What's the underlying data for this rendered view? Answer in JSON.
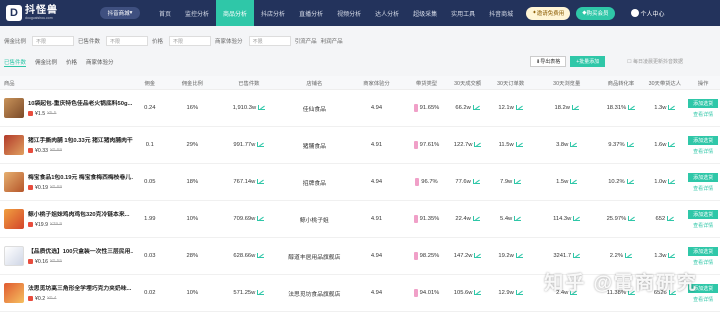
{
  "header": {
    "logo_mark": "D",
    "logo_name": "抖怪兽",
    "logo_site": "douguaishou.com",
    "platform": "抖音商城",
    "nav": [
      "首页",
      "监控分析",
      "商品分析",
      "抖店分析",
      "直播分析",
      "视频分析",
      "达人分析",
      "超级采集",
      "实用工具",
      "抖音商城"
    ],
    "active_nav": 2,
    "invite": "邀请免费用",
    "buy": "购买会员",
    "user": "个人中心"
  },
  "filters": [
    {
      "label": "佣金比例",
      "value": "不限"
    },
    {
      "label": "已售件数",
      "value": "不限"
    },
    {
      "label": "价格",
      "value": "不限"
    },
    {
      "label": "商家体验分",
      "value": "不限"
    }
  ],
  "filter_links": [
    "引流产品",
    "利润产品"
  ],
  "tabs": [
    "已售件数",
    "佣金比例",
    "价格",
    "商家体验分"
  ],
  "active_tab": 0,
  "tools": {
    "export": "导出表格",
    "add_all": "批量添加",
    "tip": "每日凌晨更新抖音数据"
  },
  "columns": [
    "商品",
    "佣金",
    "佣金比例",
    "已售件数",
    "店铺名",
    "商家体验分",
    "带货类型",
    "30天成交额",
    "30天订单数",
    "30天浏览量",
    "商品转化率",
    "30天带货达人",
    "操作"
  ],
  "rows": [
    {
      "name": "10袋起包-重庆特色佳品老火锅底料50g...",
      "price": "¥1.5",
      "old": "¥5.5",
      "comm": "0.24",
      "rate": "16%",
      "sold": "1,910.3w",
      "shop": "佳仙食品",
      "score": "4.94",
      "type": "91.65%",
      "gmv": "66.2w",
      "orders": "12.1w",
      "views": "18.2w",
      "conv": "18.31%",
      "dar": "1.3w"
    },
    {
      "name": "猪江手撕肉脯 1包0.33元 猪江猪肉脯肉干...",
      "price": "¥0.33",
      "old": "¥0.69",
      "comm": "0.1",
      "rate": "29%",
      "sold": "991.77w",
      "shop": "猪脯食品",
      "score": "4.91",
      "type": "97.61%",
      "gmv": "122.7w",
      "orders": "11.5w",
      "views": "3.8w",
      "conv": "9.37%",
      "dar": "1.6w"
    },
    {
      "name": "梅宝食品1包0.19元 梅宝食梅西梅枝卷儿童...",
      "price": "¥0.19",
      "old": "¥0.69",
      "comm": "0.05",
      "rate": "18%",
      "sold": "767.14w",
      "shop": "招牌食品",
      "score": "4.94",
      "type": "96.7%",
      "gmv": "77.6w",
      "orders": "7.9w",
      "views": "1.5w",
      "conv": "10.2%",
      "dar": "1.0w"
    },
    {
      "name": "鲸小桃子姐妹鸡肉鸡包320克冷链本来...",
      "price": "¥19.9",
      "old": "¥39.9",
      "comm": "1.99",
      "rate": "10%",
      "sold": "709.69w",
      "shop": "鲸小桃子姐",
      "score": "4.91",
      "type": "91.35%",
      "gmv": "22.4w",
      "orders": "5.4w",
      "views": "114.3w",
      "conv": "25.97%",
      "dar": "652"
    },
    {
      "name": "【品质优选】100只盒装一次性三层民用...",
      "price": "¥0.16",
      "old": "¥0.55",
      "comm": "0.03",
      "rate": "28%",
      "sold": "628.66w",
      "shop": "醇道丰居用品旗舰店",
      "score": "4.94",
      "type": "98.25%",
      "gmv": "147.2w",
      "orders": "19.2w",
      "views": "3241.7",
      "conv": "2.2%",
      "dar": "1.3w"
    },
    {
      "name": "法思觅坊高三角形全学埋巧克力夹奶味...",
      "price": "¥0.2",
      "old": "¥0.4",
      "comm": "0.02",
      "rate": "10%",
      "sold": "571.25w",
      "shop": "法思觅坊食品旗舰店",
      "score": "4.94",
      "type": "94.01%",
      "gmv": "105.6w",
      "orders": "12.9w",
      "views": "2.4w",
      "conv": "11.38%",
      "dar": "6526"
    }
  ],
  "op": {
    "add": "添加选货",
    "view": "查看详情"
  },
  "watermark": "知乎 @電商研究"
}
